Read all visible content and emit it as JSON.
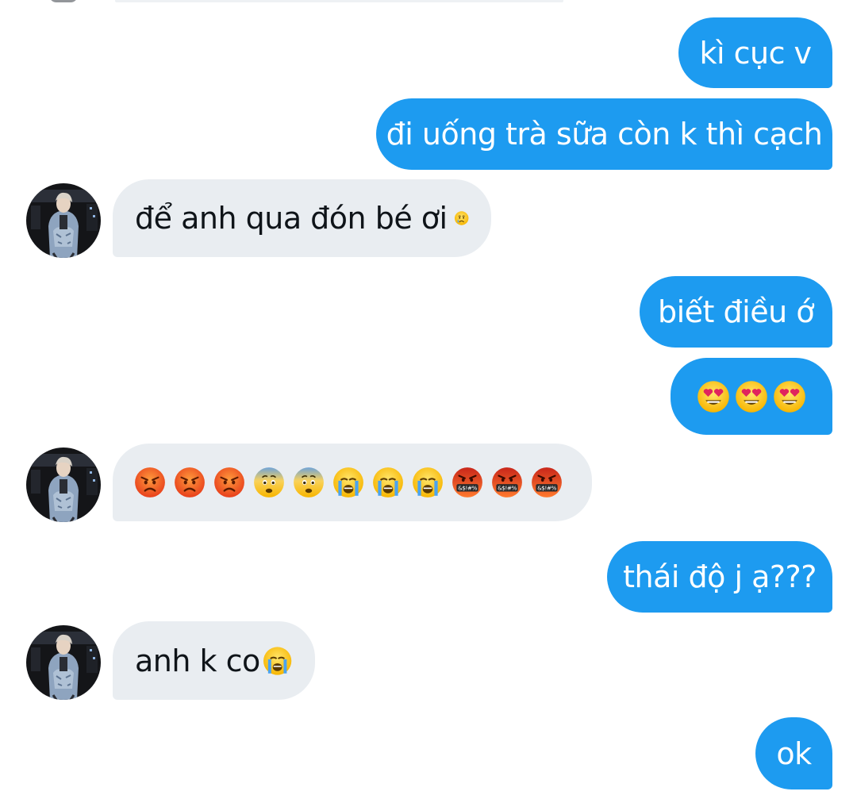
{
  "conversation": {
    "messages": [
      {
        "direction": "out",
        "text": "kì cục v"
      },
      {
        "direction": "out",
        "text": "đi uống trà sữa còn k thì cạch"
      },
      {
        "direction": "in",
        "text": "để anh qua đón bé ơi",
        "emoji": "crying-face"
      },
      {
        "direction": "out",
        "text": "biết điều ớ"
      },
      {
        "direction": "out",
        "emoji": [
          "heart-eyes-face",
          "heart-eyes-face",
          "heart-eyes-face"
        ]
      },
      {
        "direction": "in",
        "emoji": [
          "pouting-face",
          "pouting-face",
          "pouting-face",
          "fearful-face",
          "fearful-face",
          "loudly-crying-face",
          "loudly-crying-face",
          "loudly-crying-face",
          "face-with-symbols-on-mouth",
          "face-with-symbols-on-mouth",
          "face-with-symbols-on-mouth"
        ]
      },
      {
        "direction": "out",
        "text": "thái độ j ạ???"
      },
      {
        "direction": "in",
        "text": "anh k co",
        "emoji": "loudly-crying-face"
      },
      {
        "direction": "out",
        "text": "ok"
      }
    ]
  },
  "colors": {
    "outgoing_bubble": "#1d9bf0",
    "incoming_bubble": "#e9edf1",
    "outgoing_text": "#ffffff",
    "incoming_text": "#0f1419"
  }
}
